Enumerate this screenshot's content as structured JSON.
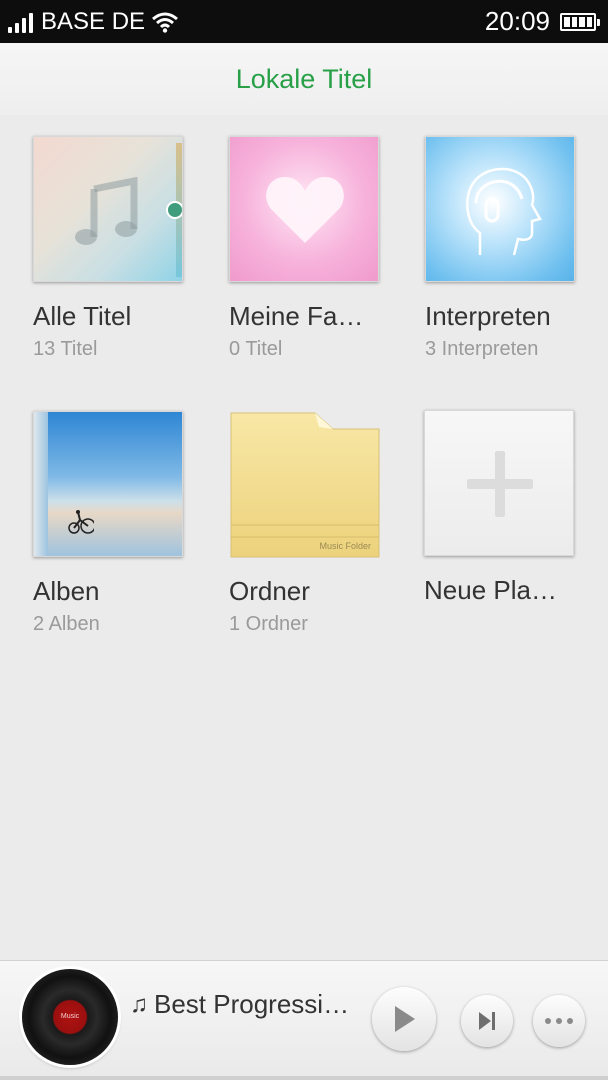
{
  "status_bar": {
    "carrier": "BASE DE",
    "time": "20:09"
  },
  "header": {
    "title": "Lokale Titel"
  },
  "tiles": [
    {
      "label": "Alle Titel",
      "count": "13 Titel"
    },
    {
      "label": "Meine Fa…",
      "count": "0 Titel"
    },
    {
      "label": "Interpreten",
      "count": "3 Interpreten"
    },
    {
      "label": "Alben",
      "count": "2 Alben"
    },
    {
      "label": "Ordner",
      "count": "1  Ordner"
    },
    {
      "label": "Neue Pla…",
      "count": ""
    }
  ],
  "folder_cover_text": "Music  Folder",
  "player": {
    "track": "Best Progressi…",
    "vinyl_label": "Music"
  },
  "colors": {
    "accent": "#27a047",
    "background": "#ebebeb",
    "status_bar": "#0d0d0d"
  }
}
